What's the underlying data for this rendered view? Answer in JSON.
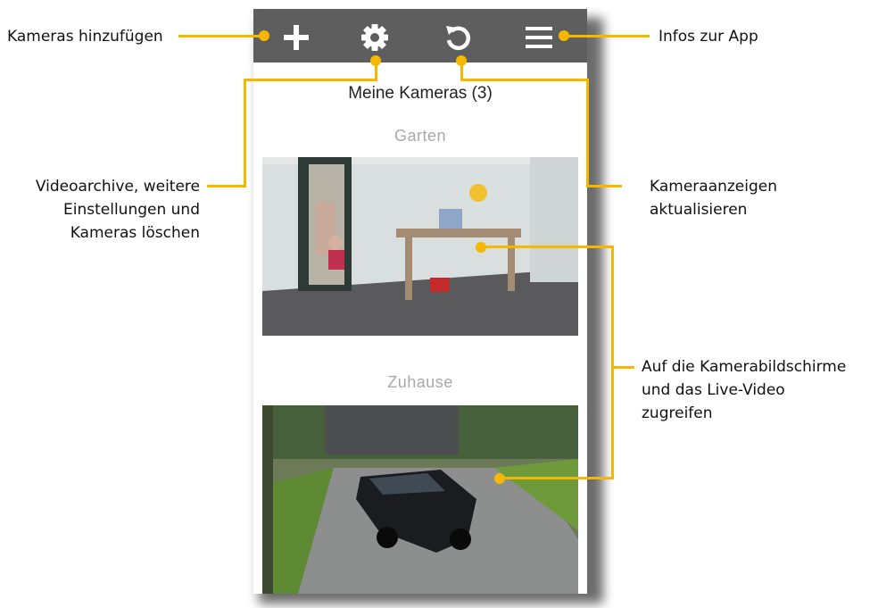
{
  "app": {
    "screen_title": "Meine Kameras (3)",
    "toolbar": {
      "add_icon": "plus-icon",
      "settings_icon": "gear-icon",
      "refresh_icon": "refresh-icon",
      "menu_icon": "hamburger-menu-icon"
    },
    "cameras": [
      {
        "name": "Garten"
      },
      {
        "name": "Zuhause"
      }
    ]
  },
  "annotations": {
    "add_cameras": "Kameras hinzufügen",
    "app_info": "Infos zur App",
    "settings_lines": [
      "Videoarchive, weitere",
      "Einstellungen und",
      "Kameras löschen"
    ],
    "refresh_lines": [
      "Kameraanzeigen",
      "aktualisieren"
    ],
    "live_lines": [
      "Auf die Kamerabildschirme",
      "und das Live-Video",
      "zugreifen"
    ]
  },
  "colors": {
    "accent": "#f5b700",
    "toolbar": "#5e5e5e"
  }
}
